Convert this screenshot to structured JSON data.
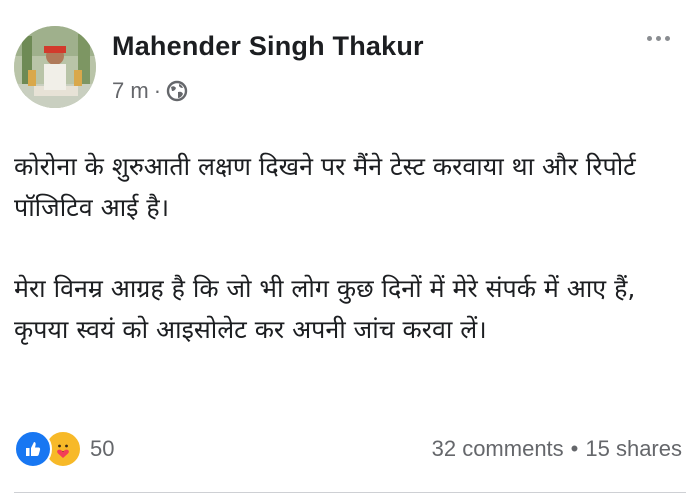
{
  "post": {
    "author": "Mahender Singh Thakur",
    "time": "7 m",
    "separator": "·",
    "audience_icon": "globe-icon",
    "options_icon": "more-options-icon",
    "paragraphs": [
      "कोरोना के शुरुआती लक्षण दिखने पर मैंने टेस्ट करवाया था और रिपोर्ट पॉजिटिव आई है।",
      "मेरा विनम्र आग्रह है कि जो भी लोग कुछ दिनों में मेरे संपर्क में आए हैं, कृपया स्वयं को आइसोलेट कर अपनी जांच करवा लें।"
    ]
  },
  "footer": {
    "reaction_icons": [
      "like-icon",
      "care-icon"
    ],
    "reaction_count": "50",
    "comments": "32 comments",
    "shares": "15 shares",
    "separator": "•"
  },
  "colors": {
    "text": "#1c1e21",
    "secondary": "#65676b",
    "like_blue": "#1877f2",
    "care_yellow": "#f7b928"
  }
}
